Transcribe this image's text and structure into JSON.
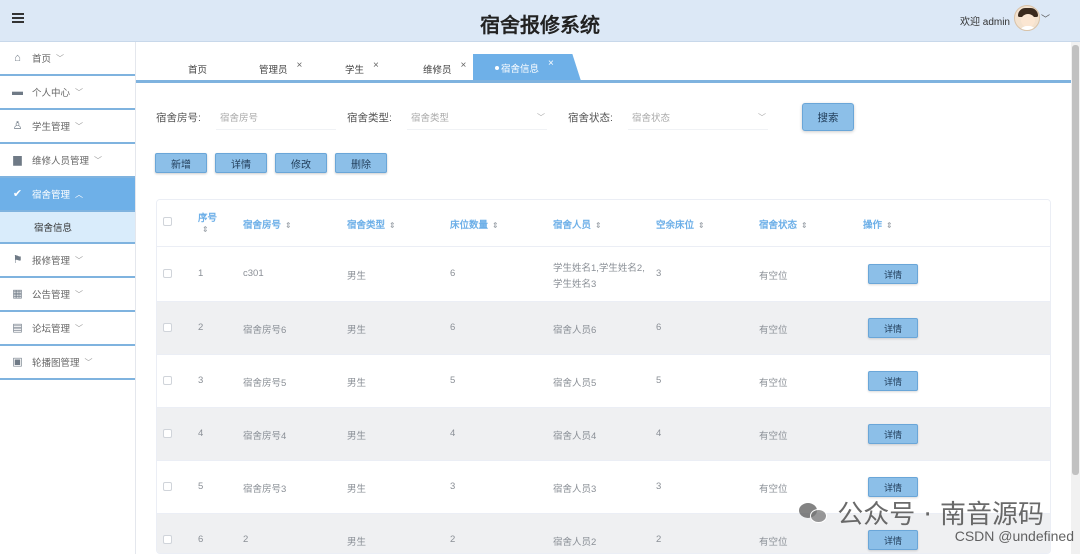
{
  "header": {
    "title": "宿舍报修系统",
    "welcome": "欢迎 admin"
  },
  "sidebar": {
    "items": [
      {
        "label": "首页",
        "icon": "home-icon"
      },
      {
        "label": "个人中心",
        "icon": "wallet-icon"
      },
      {
        "label": "学生管理",
        "icon": "user-icon"
      },
      {
        "label": "维修人员管理",
        "icon": "ticket-icon"
      },
      {
        "label": "宿舍管理",
        "icon": "check-circle-icon",
        "active": true
      },
      {
        "label": "报修管理",
        "icon": "pin-icon"
      },
      {
        "label": "公告管理",
        "icon": "grid-icon"
      },
      {
        "label": "论坛管理",
        "icon": "document-icon"
      },
      {
        "label": "轮播图管理",
        "icon": "image-icon"
      }
    ],
    "sub_item": "宿舍信息"
  },
  "tabs": [
    {
      "label": "首页",
      "closable": false
    },
    {
      "label": "管理员",
      "closable": true
    },
    {
      "label": "学生",
      "closable": true
    },
    {
      "label": "维修员",
      "closable": true
    },
    {
      "label": "宿舍信息",
      "closable": true,
      "active": true
    }
  ],
  "search": {
    "room_label": "宿舍房号:",
    "room_placeholder": "宿舍房号",
    "type_label": "宿舍类型:",
    "type_placeholder": "宿舍类型",
    "status_label": "宿舍状态:",
    "status_placeholder": "宿舍状态",
    "search_button": "搜索"
  },
  "actions": {
    "add": "新增",
    "detail": "详情",
    "edit": "修改",
    "delete": "删除"
  },
  "table": {
    "headers": {
      "index": "序号",
      "room": "宿舍房号",
      "type": "宿舍类型",
      "beds": "床位数量",
      "members": "宿舍人员",
      "free": "空余床位",
      "status": "宿舍状态",
      "op": "操作"
    },
    "rows": [
      {
        "index": "1",
        "room": "c301",
        "type": "男生",
        "beds": "6",
        "members_1": "学生姓名1,学生姓名2,",
        "members_2": "学生姓名3",
        "free": "3",
        "status": "有空位",
        "btn": "详情"
      },
      {
        "index": "2",
        "room": "宿舍房号6",
        "type": "男生",
        "beds": "6",
        "members_1": "宿舍人员6",
        "members_2": "",
        "free": "6",
        "status": "有空位",
        "btn": "详情"
      },
      {
        "index": "3",
        "room": "宿舍房号5",
        "type": "男生",
        "beds": "5",
        "members_1": "宿舍人员5",
        "members_2": "",
        "free": "5",
        "status": "有空位",
        "btn": "详情"
      },
      {
        "index": "4",
        "room": "宿舍房号4",
        "type": "男生",
        "beds": "4",
        "members_1": "宿舍人员4",
        "members_2": "",
        "free": "4",
        "status": "有空位",
        "btn": "详情"
      },
      {
        "index": "5",
        "room": "宿舍房号3",
        "type": "男生",
        "beds": "3",
        "members_1": "宿舍人员3",
        "members_2": "",
        "free": "3",
        "status": "有空位",
        "btn": "详情"
      },
      {
        "index": "6",
        "room": "2",
        "type": "男生",
        "beds": "2",
        "members_1": "宿舍人员2",
        "members_2": "",
        "free": "2",
        "status": "有空位",
        "btn": "详情"
      }
    ]
  },
  "watermark": {
    "text": "公众号 · 南音源码",
    "csdn": "CSDN @undefined"
  }
}
